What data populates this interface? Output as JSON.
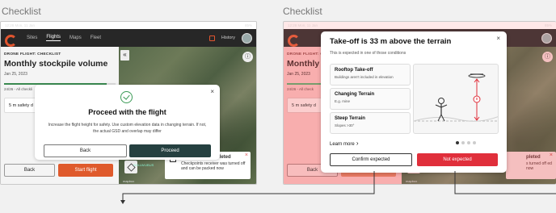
{
  "titles": {
    "left": "Checklist",
    "right": "Checklist"
  },
  "status": {
    "time": "12:28",
    "date": "Mon, 11 Jan",
    "battery": "85%"
  },
  "nav": {
    "tabs": [
      "Sites",
      "Flights",
      "Maps",
      "Fleet"
    ],
    "active_tab": "Flights",
    "history": "History"
  },
  "side": {
    "eyebrow": "DRONE FLIGHT: CHECKLIST",
    "title": "Monthly stockpile volume",
    "title_trunc": "Monthly st",
    "date": "Jan 25, 2023",
    "step": "24/26 - All checkli",
    "step_short": "24/26 - All check",
    "card": "5 m safety d",
    "back": "Back",
    "start": "Start flight",
    "progress": 0.92
  },
  "toast": {
    "title": "Measuring completed",
    "body": "Checkpoints receiver was turned off and can be packed now",
    "title2": "pleted",
    "body2": "s turned off ed now"
  },
  "map": {
    "attribution": "mapbox",
    "badge": "SOLLWLIBUS"
  },
  "modal1": {
    "title": "Proceed with the flight",
    "body": "Increase the flight height for safety. Use custom elevation data in changing terrain. If not, the actual GSD and overlap may differ",
    "back": "Back",
    "proceed": "Proceed"
  },
  "modal2": {
    "title": "Take-off is 33 m above the terrain",
    "sub": "This is expected in one of those conditions",
    "conditions": [
      {
        "title": "Rooftop Take-off",
        "desc": "Buildings aren't included in elevation"
      },
      {
        "title": "Changing Terrain",
        "desc": "E.g. mine"
      },
      {
        "title": "Steep Terrain",
        "desc": "Slopes >30°"
      }
    ],
    "learn": "Learn more",
    "confirm": "Confirm expected",
    "not": "Not expected"
  },
  "colors": {
    "accent": "#df5a2c",
    "dark": "#254040",
    "danger": "#e02f3b",
    "success": "#3a9a55"
  }
}
